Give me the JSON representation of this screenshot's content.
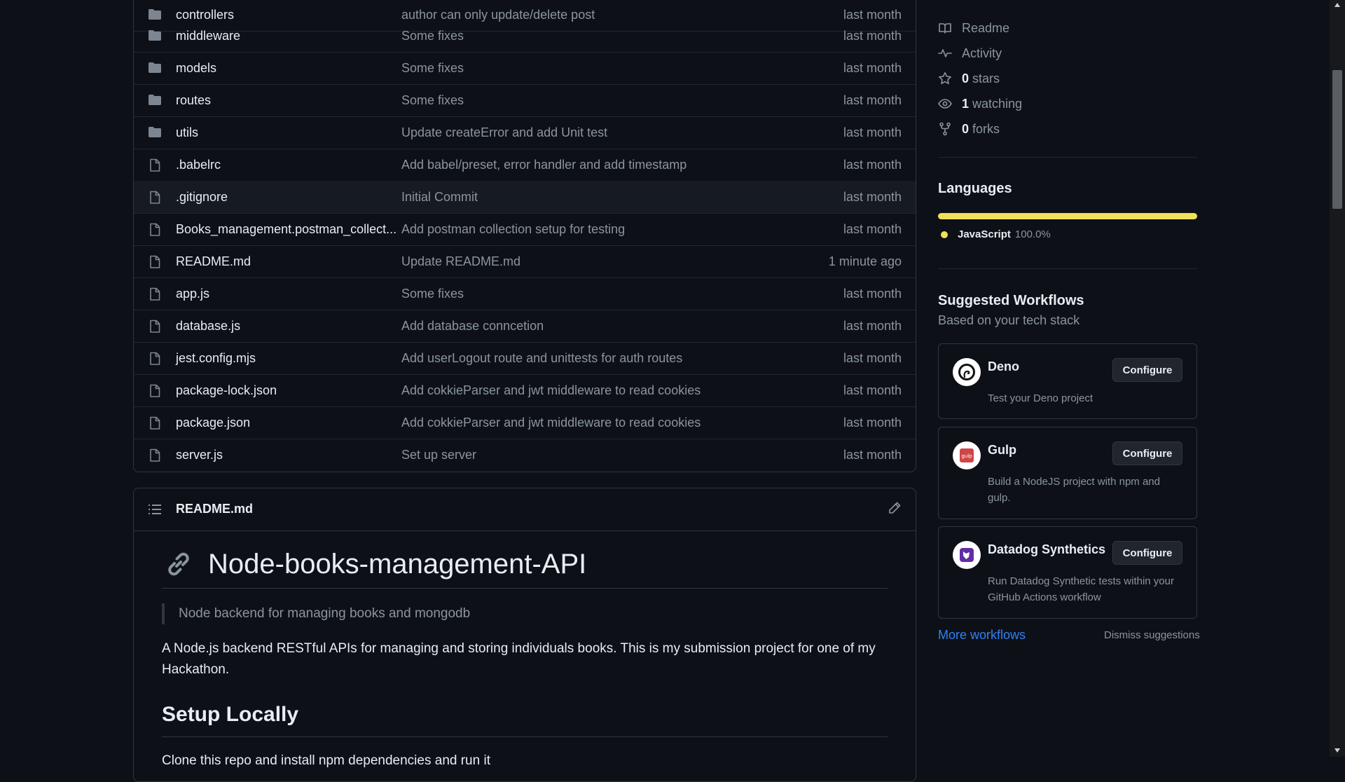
{
  "files": [
    {
      "name": "controllers",
      "type": "folder",
      "message": "author can only update/delete post",
      "time": "last month"
    },
    {
      "name": "middleware",
      "type": "folder",
      "message": "Some fixes",
      "time": "last month"
    },
    {
      "name": "models",
      "type": "folder",
      "message": "Some fixes",
      "time": "last month"
    },
    {
      "name": "routes",
      "type": "folder",
      "message": "Some fixes",
      "time": "last month"
    },
    {
      "name": "utils",
      "type": "folder",
      "message": "Update createError and add Unit test",
      "time": "last month"
    },
    {
      "name": ".babelrc",
      "type": "file",
      "message": "Add babel/preset, error handler and add timestamp",
      "time": "last month"
    },
    {
      "name": ".gitignore",
      "type": "file",
      "message": "Initial Commit",
      "time": "last month"
    },
    {
      "name": "Books_management.postman_collect...",
      "type": "file",
      "message": "Add postman collection setup for testing",
      "time": "last month"
    },
    {
      "name": "README.md",
      "type": "file",
      "message": "Update README.md",
      "time": "1 minute ago"
    },
    {
      "name": "app.js",
      "type": "file",
      "message": "Some fixes",
      "time": "last month"
    },
    {
      "name": "database.js",
      "type": "file",
      "message": "Add database conncetion",
      "time": "last month"
    },
    {
      "name": "jest.config.mjs",
      "type": "file",
      "message": "Add userLogout route and unittests for auth routes",
      "time": "last month"
    },
    {
      "name": "package-lock.json",
      "type": "file",
      "message": "Add cokkieParser and jwt middleware to read cookies",
      "time": "last month"
    },
    {
      "name": "package.json",
      "type": "file",
      "message": "Add cokkieParser and jwt middleware to read cookies",
      "time": "last month"
    },
    {
      "name": "server.js",
      "type": "file",
      "message": "Set up server",
      "time": "last month"
    }
  ],
  "readme": {
    "filename": "README.md",
    "h1": "Node-books-management-API",
    "blockquote": "Node backend for managing books and mongodb",
    "paragraph": "A Node.js backend RESTful APIs for managing and storing individuals books. This is my submission project for one of my Hackathon.",
    "h2": "Setup Locally",
    "paragraph2": "Clone this repo and install npm dependencies and run it"
  },
  "sidebar": {
    "items": [
      {
        "icon": "book-icon",
        "count": "",
        "label": "Readme"
      },
      {
        "icon": "pulse-icon",
        "count": "",
        "label": "Activity"
      },
      {
        "icon": "star-icon",
        "count": "0",
        "label": "stars"
      },
      {
        "icon": "eye-icon",
        "count": "1",
        "label": "watching"
      },
      {
        "icon": "fork-icon",
        "count": "0",
        "label": "forks"
      }
    ],
    "languages_title": "Languages",
    "language": {
      "name": "JavaScript",
      "percent": "100.0%",
      "color": "#f1e05a",
      "fraction": 1.0
    },
    "workflows_title": "Suggested Workflows",
    "workflows_subtitle": "Based on your tech stack",
    "workflows": [
      {
        "name": "Deno",
        "description": "Test your Deno project",
        "button": "Configure"
      },
      {
        "name": "Gulp",
        "description": "Build a NodeJS project with npm and gulp.",
        "button": "Configure"
      },
      {
        "name": "Datadog Synthetics",
        "description": "Run Datadog Synthetic tests within your GitHub Actions workflow",
        "button": "Configure"
      }
    ],
    "more_workflows": "More workflows",
    "dismiss": "Dismiss suggestions"
  },
  "colors": {
    "background": "#0d1117",
    "link": "#2f81f7",
    "border": "#30363d",
    "muted_text": "#8b949e"
  }
}
